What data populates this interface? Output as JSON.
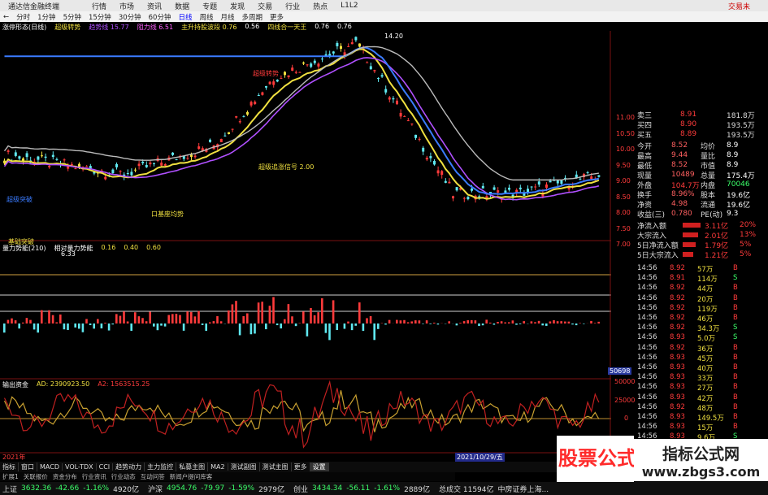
{
  "menu": {
    "app_title": "通达信金融终端",
    "items": [
      "行情",
      "市场",
      "资讯",
      "数据",
      "专题",
      "发现",
      "交易",
      "行业",
      "热点",
      "L1L2"
    ],
    "trade_label": "交易未"
  },
  "period_tabs": [
    "分时",
    "1分钟",
    "5分钟",
    "15分钟",
    "30分钟",
    "60分钟",
    "日线",
    "周线",
    "月线",
    "多周期",
    "更多"
  ],
  "active_period": "日线",
  "main_panel": {
    "name": "涨停形态(日线)",
    "indicator": "超级转势",
    "params": [
      "趋势线 15.77",
      "阻力线 6.51",
      "主升持股波段 0.76",
      "0.56",
      "四线合一天王",
      "0.76",
      "0.76"
    ],
    "label_tag": "超级转势",
    "callout_high": "14.20",
    "callout_low": "6.33",
    "annotation_a": "超级追涨信号 2.00",
    "annotation_b": "口基座均势",
    "annotation_c": "基础突破",
    "left_tag": "超级突破"
  },
  "vol_panel": {
    "name": "量力势能(210)",
    "params": [
      "相对量力势能",
      "0.16",
      "0.40",
      "0.60"
    ]
  },
  "mid_panel": {
    "name": "输出资金",
    "ad_label": "AD: 2390923.50",
    "ad2_label": "A2: 1563515.25"
  },
  "axis_main": [
    "11.00",
    "10.50",
    "10.00",
    "9.50",
    "9.00",
    "8.50",
    "8.00",
    "7.50",
    "7.00"
  ],
  "axis_mid": [
    "50000",
    "25000",
    "0"
  ],
  "axis_mid_tag": "50698",
  "time_labels": {
    "left": "2021年",
    "bottom": "2021/10/29/五"
  },
  "quote": {
    "ask_rows": [
      {
        "label": "卖三",
        "price": "8.91",
        "vol": "181.8万"
      },
      {
        "label": "买四",
        "price": "8.90",
        "vol": "193.5万"
      },
      {
        "label": "买五",
        "price": "8.89",
        "vol": "193.5万"
      }
    ],
    "stats": [
      {
        "l1": "今开",
        "v1": "8.52",
        "l2": "均价",
        "v2": "8.9"
      },
      {
        "l1": "最高",
        "v1": "9.44",
        "l2": "量比",
        "v2": "8.9"
      },
      {
        "l1": "最低",
        "v1": "8.52",
        "l2": "市值",
        "v2": "8.9"
      },
      {
        "l1": "现量",
        "v1": "10489",
        "l2": "总量",
        "v2": "175.4万"
      },
      {
        "l1": "外盘",
        "v1": "104.7万",
        "l2": "内盘",
        "v2": "70046"
      },
      {
        "l1": "换手",
        "v1": "8.96%",
        "l2": "股本",
        "v2": "19.6亿"
      },
      {
        "l1": "净资",
        "v1": "4.98",
        "l2": "流通",
        "v2": "19.6亿"
      },
      {
        "l1": "收益(三)",
        "v1": "0.780",
        "l2": "PE(动)",
        "v2": "9.3"
      }
    ],
    "flows": [
      {
        "label": "净流入额",
        "value": "3.11亿",
        "pct": "20%"
      },
      {
        "label": "大宗流入",
        "value": "2.01亿",
        "pct": "13%"
      },
      {
        "label": "5日净流入额",
        "value": "1.79亿",
        "pct": "5%"
      },
      {
        "label": "5日大宗流入",
        "value": "1.21亿",
        "pct": "5%"
      }
    ],
    "ticks": [
      {
        "t": "14:56",
        "p": "8.92",
        "v": "57万",
        "s": "B"
      },
      {
        "t": "14:56",
        "p": "8.91",
        "v": "114万",
        "s": "S"
      },
      {
        "t": "14:56",
        "p": "8.92",
        "v": "44万",
        "s": "B"
      },
      {
        "t": "14:56",
        "p": "8.92",
        "v": "20万",
        "s": "B"
      },
      {
        "t": "14:56",
        "p": "8.92",
        "v": "119万",
        "s": "B"
      },
      {
        "t": "14:56",
        "p": "8.92",
        "v": "46万",
        "s": "B"
      },
      {
        "t": "14:56",
        "p": "8.92",
        "v": "34.3万",
        "s": "S"
      },
      {
        "t": "14:56",
        "p": "8.93",
        "v": "5.0万",
        "s": "S"
      },
      {
        "t": "14:56",
        "p": "8.92",
        "v": "36万",
        "s": "B"
      },
      {
        "t": "14:56",
        "p": "8.93",
        "v": "45万",
        "s": "B"
      },
      {
        "t": "14:56",
        "p": "8.93",
        "v": "40万",
        "s": "B"
      },
      {
        "t": "14:56",
        "p": "8.93",
        "v": "33万",
        "s": "B"
      },
      {
        "t": "14:56",
        "p": "8.93",
        "v": "27万",
        "s": "B"
      },
      {
        "t": "14:56",
        "p": "8.93",
        "v": "42万",
        "s": "B"
      },
      {
        "t": "14:56",
        "p": "8.92",
        "v": "48万",
        "s": "B"
      },
      {
        "t": "14:56",
        "p": "8.93",
        "v": "149.5万",
        "s": "B"
      },
      {
        "t": "14:56",
        "p": "8.93",
        "v": "15万",
        "s": "B"
      },
      {
        "t": "14:56",
        "p": "8.93",
        "v": "9.6万",
        "s": "S"
      },
      {
        "t": "14:56",
        "p": "8.93",
        "v": "50万",
        "s": "B"
      },
      {
        "t": "14:56",
        "p": "8.92",
        "v": "12万",
        "s": "B"
      },
      {
        "t": "14:56",
        "p": "8.93",
        "v": "29万",
        "s": "B"
      }
    ]
  },
  "bottom_tabs": [
    "指标",
    "窗口",
    "MACD",
    "VOL-TDX",
    "CCI",
    "趋势动力",
    "主力监控",
    "私募主图",
    "MA2",
    "测试副图",
    "测试主图",
    "更多",
    "设置"
  ],
  "sub_tabs": [
    "扩展1",
    "关联报价",
    "资金分布",
    "行业资讯",
    "行业动态",
    "互动问答",
    "新闻户提问库客"
  ],
  "status": [
    {
      "name": "上证",
      "val": "3632.36",
      "chg": "-42.66",
      "pct": "-1.16%",
      "amt": "4920亿"
    },
    {
      "name": "沪深",
      "val": "4954.76",
      "chg": "-79.97",
      "pct": "-1.59%",
      "amt": "2979亿"
    },
    {
      "name": "创业",
      "val": "3434.34",
      "chg": "-56.11",
      "pct": "-1.61%",
      "amt": "2889亿"
    }
  ],
  "status_total": "总成交 11594亿",
  "status_tail": "中房证券上海...",
  "watermark_left": "股票公式指标网",
  "watermark_right_title": "指标公式网",
  "watermark_right_url": "www.zbgs3.com",
  "colors": {
    "up": "#ff3b3b",
    "down": "#5fe8f0",
    "yellow": "#f0e040",
    "purple": "#b050ff",
    "blue": "#3a7bff",
    "gray": "#bbbbbb",
    "white": "#ffffff"
  }
}
